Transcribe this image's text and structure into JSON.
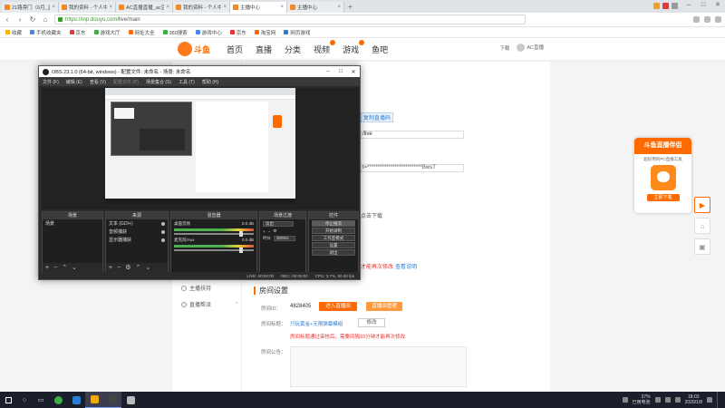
{
  "browser": {
    "tabs": [
      {
        "label": "21路旁门（6月_直播_斗鱼",
        "active": false
      },
      {
        "label": "我的资料 - 个人中心 - 斗鱼",
        "active": false
      },
      {
        "label": "AC直播直播_ac豆豆之家直播",
        "active": false
      },
      {
        "label": "我的资料 - 个人中心 - 斗鱼",
        "active": false
      },
      {
        "label": "主播中心",
        "active": true
      },
      {
        "label": "主播中心",
        "active": false
      }
    ],
    "url_host": "https://mp.douyu.com",
    "url_path": "/live/main",
    "bookmarks": [
      "收藏",
      "手机收藏夹",
      "京东",
      "游戏大厅",
      "网址大全",
      "360搜索",
      "游戏中心",
      "京东",
      "淘宝网",
      "网页游戏"
    ]
  },
  "site": {
    "logo_text": "斗鱼",
    "nav": [
      {
        "label": "首页",
        "active": false,
        "dot": false
      },
      {
        "label": "直播",
        "active": false,
        "dot": false
      },
      {
        "label": "分类",
        "active": false,
        "dot": false
      },
      {
        "label": "视频",
        "active": false,
        "dot": true
      },
      {
        "label": "游戏",
        "active": false,
        "dot": true
      },
      {
        "label": "鱼吧",
        "active": false,
        "dot": false
      }
    ],
    "download": "下载",
    "username": "AC直播"
  },
  "left_menu": [
    {
      "label": "主播扶持"
    },
    {
      "label": "直播帮派",
      "chev": "^"
    }
  ],
  "room_settings": {
    "section_title": "房间设置",
    "room_id_label": "房间ID：",
    "room_id": "4828405",
    "enter_room_btn": "进入直播间",
    "manage_btn": "直播间管理",
    "title_label": "房间标题：",
    "title_value": "只玩黄金+无限弹幕模组",
    "edit_btn": "修改",
    "title_warning": "房间标题通过审核后，需要间隔10分钟才能再次修改",
    "notice_label": "房间公告："
  },
  "ghost": {
    "link1": "复制直播码",
    "live": "/live",
    "key": "t=**************************BwsT",
    "download_tip": "点击下载",
    "red_tip": "才能再次修改",
    "blue_tip": "查看说明"
  },
  "promo": {
    "title": "斗鱼直播伴侣",
    "subtitle": "超好用的PC直播工具",
    "button": "立即下载"
  },
  "obs": {
    "title": "OBS 23.1.0 (64-bit, windows) - 配置文件: 未命名 - 场景: 未命名",
    "menu": [
      "文件 (F)",
      "编辑 (E)",
      "查看 (V)",
      "配置文件 (P)",
      "场景集合 (S)",
      "工具 (T)",
      "帮助 (H)"
    ],
    "menu_dim": [
      false,
      false,
      false,
      true,
      false,
      false,
      false
    ],
    "docks": {
      "scenes_title": "场景",
      "scenes": [
        "场景"
      ],
      "sources_title": "来源",
      "sources": [
        "文本 (GDI+)",
        "音频捕获",
        "显示器捕获"
      ],
      "mixer_title": "混音器",
      "mixer": [
        {
          "name": "桌面音频",
          "db": "0.0 dB"
        },
        {
          "name": "麦克风/Aux",
          "db": "0.0 dB"
        }
      ],
      "transitions_title": "场景过渡",
      "transition_type": "淡出",
      "duration_label": "时长",
      "duration_value": "300ms",
      "controls_title": "控件",
      "controls": [
        "停止推流",
        "开始录制",
        "工作室模式",
        "设置",
        "退出"
      ]
    },
    "status": [
      "LIVE: 00:00:00",
      "REC: 00:00:00",
      "CPU: 3.7%, 60.00 fps"
    ]
  },
  "taskbar": {
    "battery": "37%",
    "battery_sub": "已用电池",
    "time": "18:03",
    "date": "2020/1/8",
    "apps": [
      {
        "color": "#3fae49",
        "active": false
      },
      {
        "color": "#2b7ed6",
        "active": false
      },
      {
        "color": "#f2a900",
        "active": true
      },
      {
        "color": "#444444",
        "active": true
      },
      {
        "color": "#bbbbbb",
        "active": false
      }
    ]
  }
}
